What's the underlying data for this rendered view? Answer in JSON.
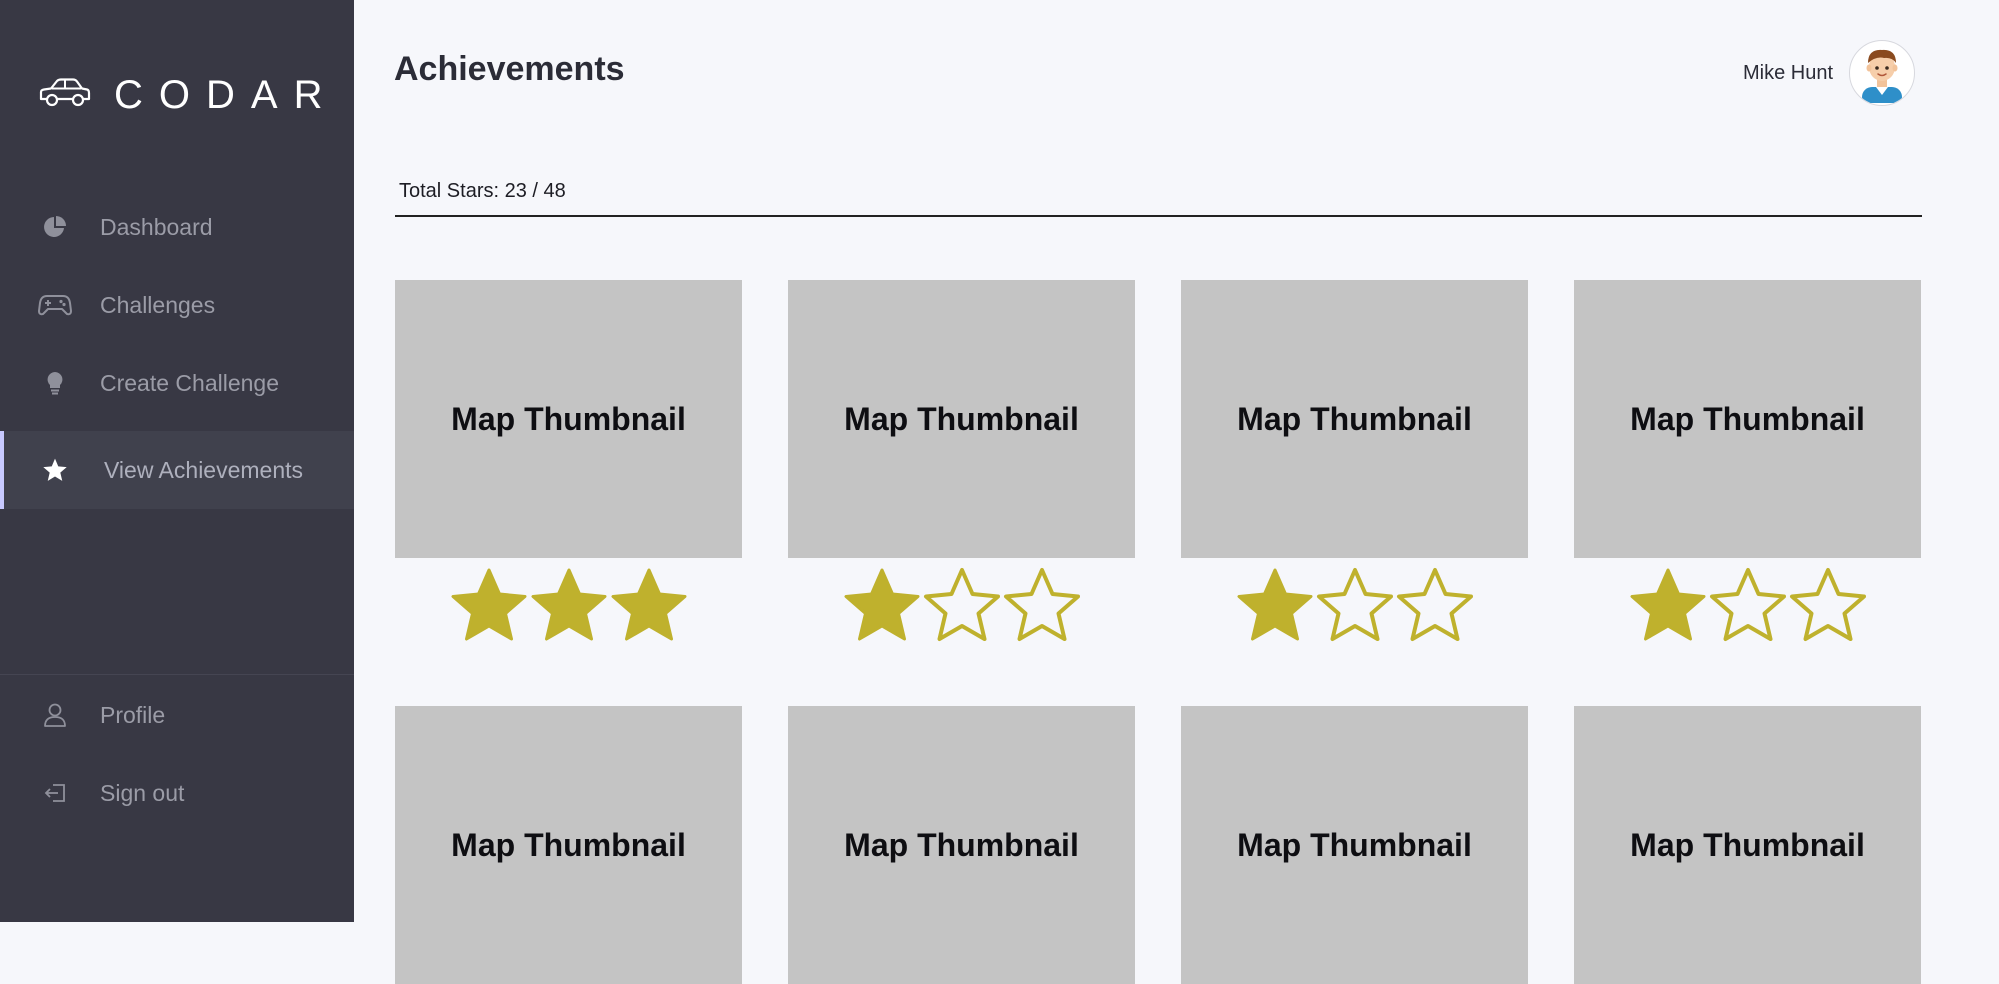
{
  "brand": {
    "name": "CODAR"
  },
  "sidebar": {
    "items": [
      {
        "label": "Dashboard"
      },
      {
        "label": "Challenges"
      },
      {
        "label": "Create Challenge"
      },
      {
        "label": "View Achievements",
        "active": true
      }
    ],
    "bottom_items": [
      {
        "label": "Profile"
      },
      {
        "label": "Sign out"
      }
    ]
  },
  "header": {
    "title": "Achievements",
    "user_name": "Mike Hunt"
  },
  "summary": {
    "total_stars_text": "Total Stars: 23 / 48",
    "earned": 23,
    "total": 48
  },
  "cards": [
    {
      "label": "Map Thumbnail",
      "stars_earned": 3,
      "stars_total": 3
    },
    {
      "label": "Map Thumbnail",
      "stars_earned": 1,
      "stars_total": 3
    },
    {
      "label": "Map Thumbnail",
      "stars_earned": 1,
      "stars_total": 3
    },
    {
      "label": "Map Thumbnail",
      "stars_earned": 1,
      "stars_total": 3
    },
    {
      "label": "Map Thumbnail"
    },
    {
      "label": "Map Thumbnail"
    },
    {
      "label": "Map Thumbnail"
    },
    {
      "label": "Map Thumbnail"
    }
  ],
  "colors": {
    "sidebar_bg": "#383844",
    "page_bg": "#f6f7fb",
    "star": "#bfb12d",
    "thumb_bg": "#c4c4c4",
    "active_indicator": "#c8c9ff"
  },
  "icons": {
    "brand": "car-icon",
    "dashboard": "pie-chart-icon",
    "challenges": "gamepad-icon",
    "create_challenge": "lightbulb-icon",
    "view_achievements": "star-icon",
    "profile": "user-icon",
    "sign_out": "sign-out-icon"
  }
}
